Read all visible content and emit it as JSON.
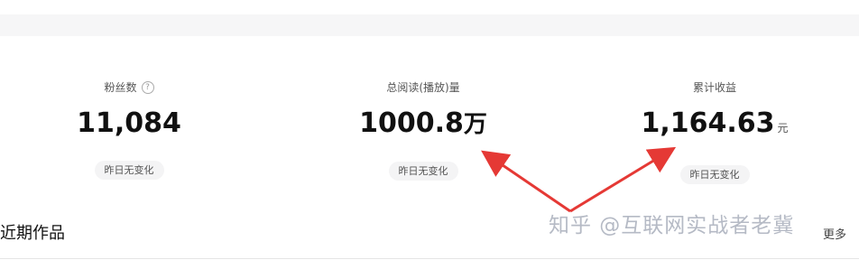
{
  "stats": [
    {
      "label": "粉丝数",
      "value": "11,084",
      "unit": "",
      "change": "昨日无变化"
    },
    {
      "label": "总阅读(播放)量",
      "value": "1000.8",
      "unit": "万",
      "change": "昨日无变化"
    },
    {
      "label": "累计收益",
      "value": "1,164.63",
      "unit": "元",
      "change": "昨日无变化"
    }
  ],
  "help_icon_glyph": "?",
  "section": {
    "title": "近期作品",
    "more": "更多"
  },
  "watermark": "知乎 @互联网实战者老冀",
  "colors": {
    "arrow": "#e53935",
    "badge_bg": "#f4f4f5"
  }
}
